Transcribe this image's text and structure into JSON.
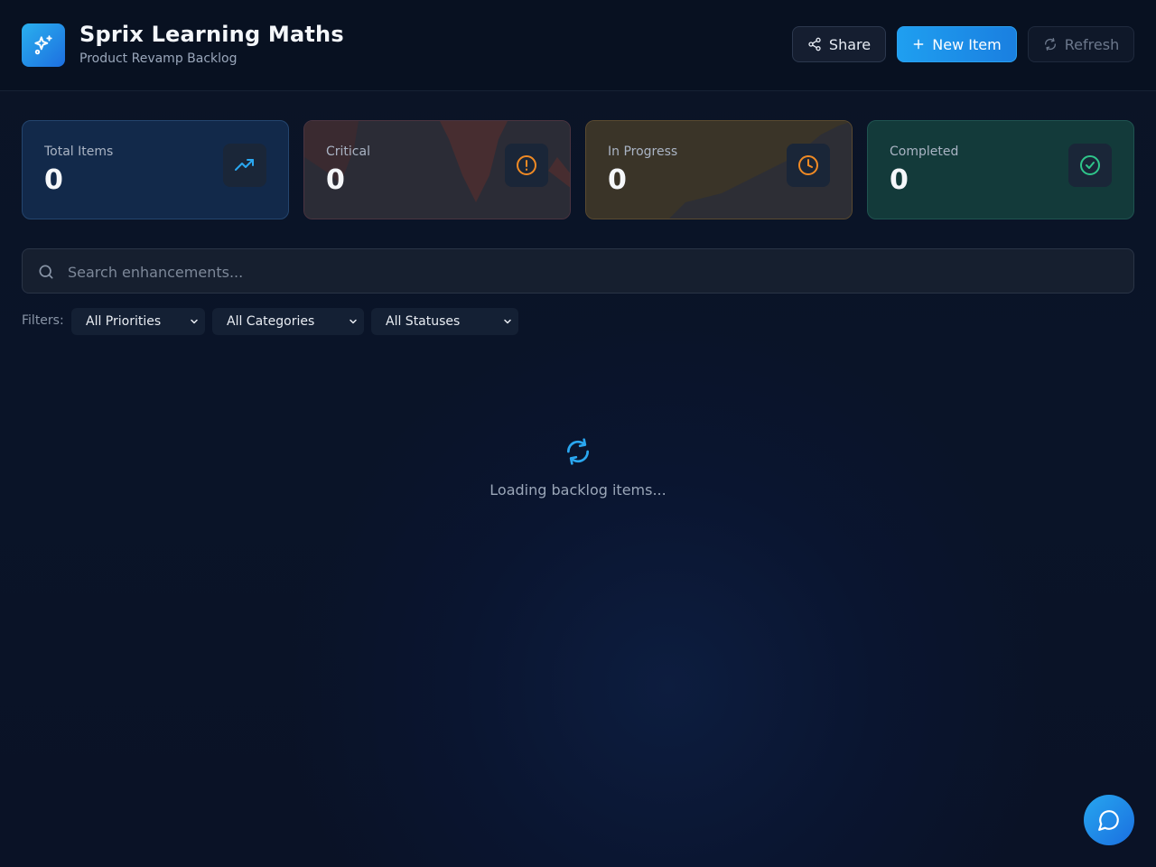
{
  "header": {
    "title": "Sprix Learning Maths",
    "subtitle": "Product Revamp Backlog",
    "logo_icon": "sparkles-icon",
    "buttons": {
      "share": "Share",
      "new_item": "New Item",
      "refresh": "Refresh"
    }
  },
  "stats": [
    {
      "label": "Total Items",
      "value": "0",
      "icon": "trending-up-icon",
      "color": "#2aa7f0"
    },
    {
      "label": "Critical",
      "value": "0",
      "icon": "alert-circle-icon",
      "color": "#f08a24"
    },
    {
      "label": "In Progress",
      "value": "0",
      "icon": "clock-icon",
      "color": "#f08a24"
    },
    {
      "label": "Completed",
      "value": "0",
      "icon": "check-circle-icon",
      "color": "#2fc58a"
    }
  ],
  "search": {
    "placeholder": "Search enhancements..."
  },
  "filters": {
    "label": "Filters:",
    "priority": "All Priorities",
    "category": "All Categories",
    "status": "All Statuses"
  },
  "loading": {
    "text": "Loading backlog items..."
  },
  "chat": {
    "icon": "chat-bubble-icon"
  }
}
